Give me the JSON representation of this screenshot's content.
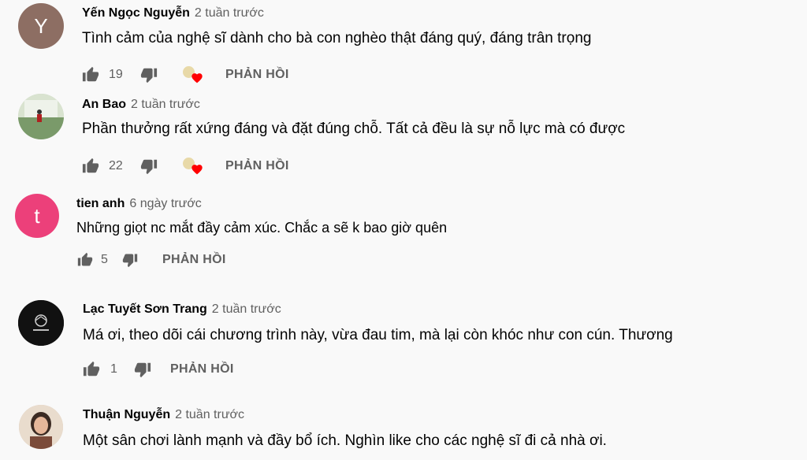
{
  "colors": {
    "background": "#f9f9f9",
    "text": "#030303",
    "secondary": "#606060",
    "heart": "#ff0000"
  },
  "comments": [
    {
      "author": "Yến Ngọc Nguyễn",
      "time": "2 tuần trước",
      "text": "Tình cảm của nghệ sĩ dành cho bà con nghèo thật đáng quý, đáng trân trọng",
      "likes": "19",
      "reply": "PHẢN HỒI",
      "avatar_letter": "Y",
      "avatar_color": "#8d6e63",
      "hearted": true
    },
    {
      "author": "An Bao",
      "time": "2 tuần trước",
      "text": "Phần thưởng rất xứng đáng và đặt đúng chỗ. Tất cả đều là sự nỗ lực mà có được",
      "likes": "22",
      "reply": "PHẢN HỒI",
      "avatar_letter": "",
      "avatar_color": "#c9d6c0",
      "hearted": true
    },
    {
      "author": "tien anh",
      "time": "6 ngày trước",
      "text": "Những giọt nc mắt đầy cảm xúc. Chắc a sẽ k bao giờ quên",
      "likes": "5",
      "reply": "PHẢN HỒI",
      "avatar_letter": "t",
      "avatar_color": "#ec407a",
      "hearted": false
    },
    {
      "author": "Lạc Tuyết Sơn Trang",
      "time": "2 tuần trước",
      "text": "Má ơi, theo dõi cái chương trình này, vừa đau tim, mà lại còn khóc như con cún. Thương",
      "likes": "1",
      "reply": "PHẢN HỒI",
      "avatar_letter": "",
      "avatar_color": "#111111",
      "hearted": false
    },
    {
      "author": "Thuận Nguyễn",
      "time": "2 tuần trước",
      "text": "Một sân chơi lành mạnh và đầy bổ ích. Nghìn like cho các nghệ sĩ đi cả nhà ơi.",
      "likes": "",
      "reply": "",
      "avatar_letter": "",
      "avatar_color": "#d7c4b3",
      "hearted": false
    }
  ]
}
